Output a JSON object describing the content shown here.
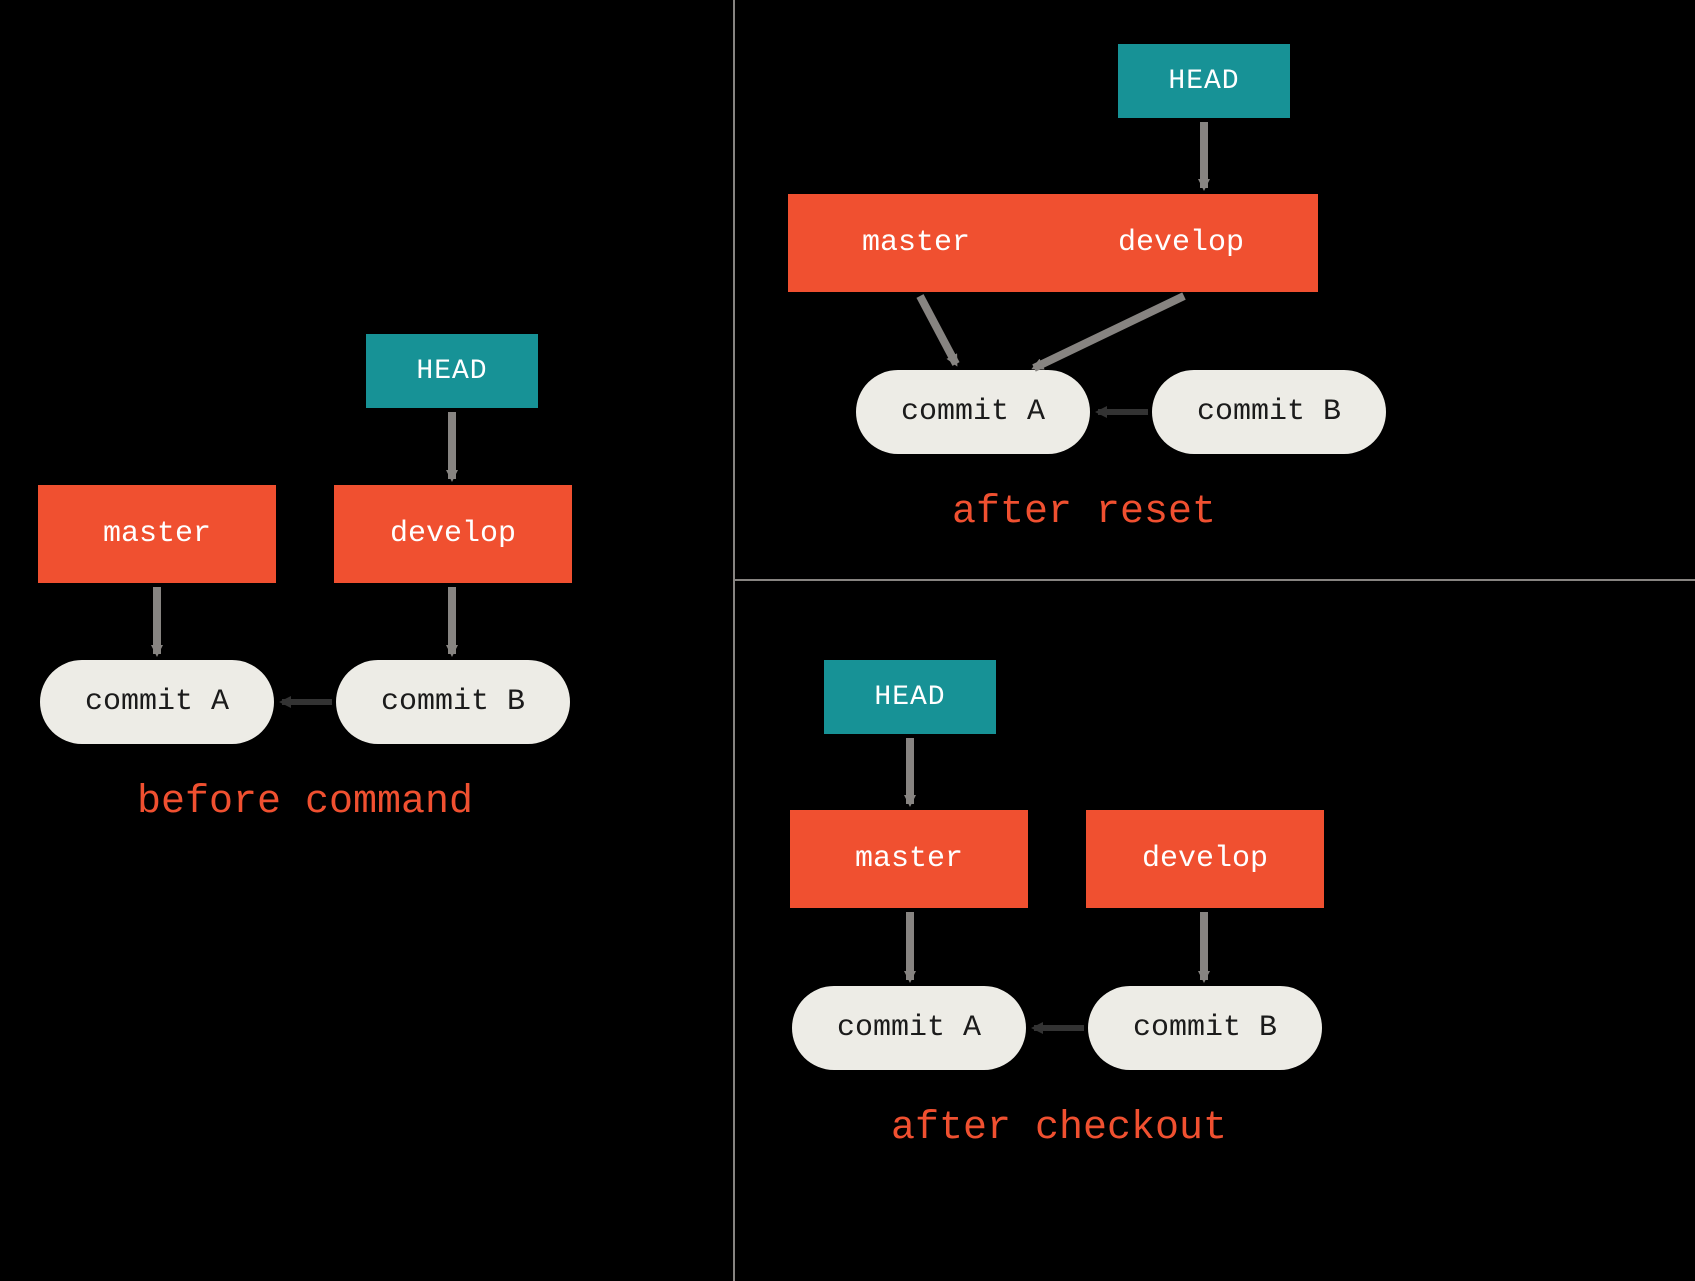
{
  "colors": {
    "head": "#179296",
    "branch": "#F05030",
    "commit_bg": "#EDECE6",
    "commit_fg": "#1b1b1b",
    "caption": "#F05030",
    "arrow": "#878481",
    "arrow_dark": "#333333",
    "divider": "#878481"
  },
  "labels": {
    "head": "HEAD",
    "master": "master",
    "develop": "develop",
    "commit_a": "commit A",
    "commit_b": "commit B"
  },
  "panels": {
    "before": {
      "caption": "before command",
      "head_points_to": "develop",
      "branches": [
        {
          "name": "master",
          "points_to": "commit A"
        },
        {
          "name": "develop",
          "points_to": "commit B"
        }
      ],
      "commits": [
        {
          "id": "commit A",
          "parents": []
        },
        {
          "id": "commit B",
          "parents": [
            "commit A"
          ]
        }
      ]
    },
    "after_reset": {
      "caption": "after reset",
      "head_points_to": "develop",
      "branches": [
        {
          "name": "master",
          "points_to": "commit A"
        },
        {
          "name": "develop",
          "points_to": "commit A"
        }
      ],
      "commits": [
        {
          "id": "commit A",
          "parents": []
        },
        {
          "id": "commit B",
          "parents": [
            "commit A"
          ]
        }
      ]
    },
    "after_checkout": {
      "caption": "after checkout",
      "head_points_to": "master",
      "branches": [
        {
          "name": "master",
          "points_to": "commit A"
        },
        {
          "name": "develop",
          "points_to": "commit B"
        }
      ],
      "commits": [
        {
          "id": "commit A",
          "parents": []
        },
        {
          "id": "commit B",
          "parents": [
            "commit A"
          ]
        }
      ]
    }
  }
}
